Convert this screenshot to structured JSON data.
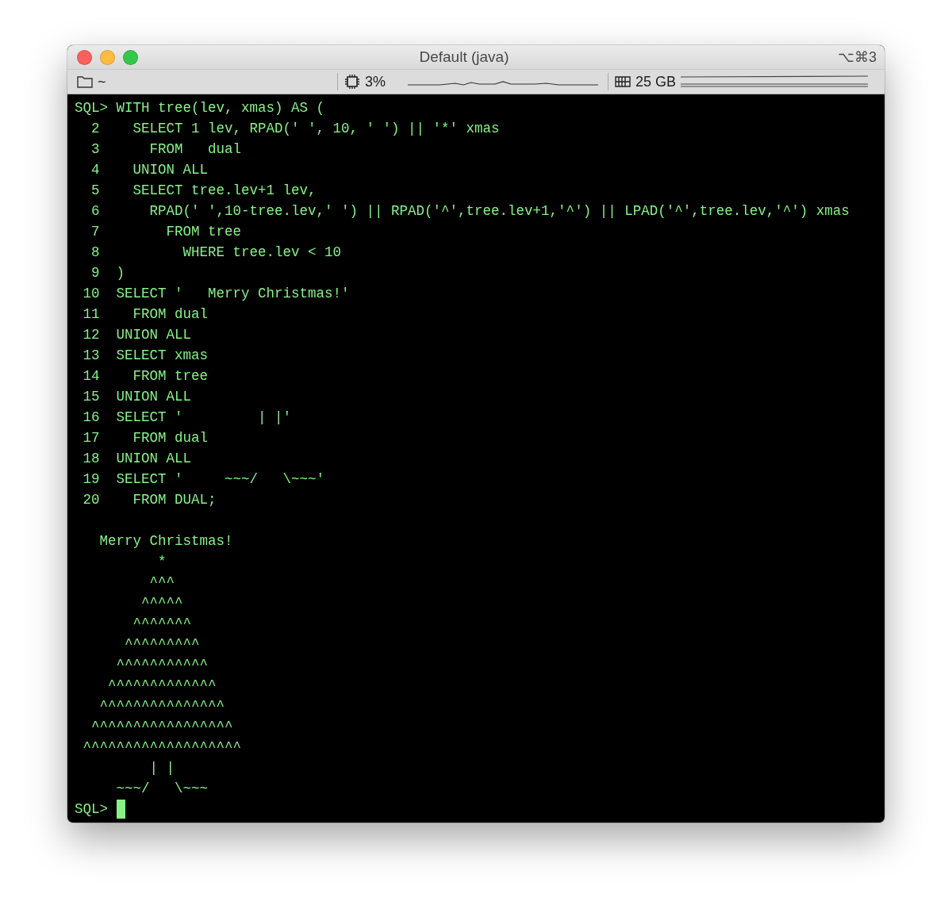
{
  "window": {
    "title": "Default (java)",
    "shortcut": "⌥⌘3"
  },
  "status_bar": {
    "directory": "~",
    "cpu": "3%",
    "memory": "25 GB"
  },
  "terminal": {
    "lines": [
      {
        "kind": "prompt",
        "prompt": "SQL>",
        "text": "WITH tree(lev, xmas) AS ("
      },
      {
        "kind": "numbered",
        "number": "2",
        "text": "  SELECT 1 lev, RPAD(' ', 10, ' ') || '*' xmas"
      },
      {
        "kind": "numbered",
        "number": "3",
        "text": "    FROM   dual"
      },
      {
        "kind": "numbered",
        "number": "4",
        "text": "  UNION ALL"
      },
      {
        "kind": "numbered",
        "number": "5",
        "text": "  SELECT tree.lev+1 lev,"
      },
      {
        "kind": "numbered",
        "number": "6",
        "text": "    RPAD(' ',10-tree.lev,' ') || RPAD('^',tree.lev+1,'^') || LPAD('^',tree.lev,'^') xmas"
      },
      {
        "kind": "numbered",
        "number": "7",
        "text": "      FROM tree"
      },
      {
        "kind": "numbered",
        "number": "8",
        "text": "        WHERE tree.lev < 10"
      },
      {
        "kind": "numbered",
        "number": "9",
        "text": ")"
      },
      {
        "kind": "numbered",
        "number": "10",
        "text": "SELECT '   Merry Christmas!'"
      },
      {
        "kind": "numbered",
        "number": "11",
        "text": "  FROM dual"
      },
      {
        "kind": "numbered",
        "number": "12",
        "text": "UNION ALL"
      },
      {
        "kind": "numbered",
        "number": "13",
        "text": "SELECT xmas"
      },
      {
        "kind": "numbered",
        "number": "14",
        "text": "  FROM tree"
      },
      {
        "kind": "numbered",
        "number": "15",
        "text": "UNION ALL"
      },
      {
        "kind": "numbered",
        "number": "16",
        "text": "SELECT '         | |'"
      },
      {
        "kind": "numbered",
        "number": "17",
        "text": "  FROM dual"
      },
      {
        "kind": "numbered",
        "number": "18",
        "text": "UNION ALL"
      },
      {
        "kind": "numbered",
        "number": "19",
        "text": "SELECT '     ~~~/   \\~~~'"
      },
      {
        "kind": "numbered",
        "number": "20",
        "text": "  FROM DUAL;"
      },
      {
        "kind": "blank"
      },
      {
        "kind": "output",
        "text": "   Merry Christmas!"
      },
      {
        "kind": "output",
        "text": "          *"
      },
      {
        "kind": "output",
        "text": "         ^^^"
      },
      {
        "kind": "output",
        "text": "        ^^^^^"
      },
      {
        "kind": "output",
        "text": "       ^^^^^^^"
      },
      {
        "kind": "output",
        "text": "      ^^^^^^^^^"
      },
      {
        "kind": "output",
        "text": "     ^^^^^^^^^^^"
      },
      {
        "kind": "output",
        "text": "    ^^^^^^^^^^^^^"
      },
      {
        "kind": "output",
        "text": "   ^^^^^^^^^^^^^^^"
      },
      {
        "kind": "output",
        "text": "  ^^^^^^^^^^^^^^^^^"
      },
      {
        "kind": "output",
        "text": " ^^^^^^^^^^^^^^^^^^^"
      },
      {
        "kind": "output",
        "text": "         | |"
      },
      {
        "kind": "output",
        "text": "     ~~~/   \\~~~"
      },
      {
        "kind": "input",
        "prompt": "SQL>"
      }
    ]
  }
}
